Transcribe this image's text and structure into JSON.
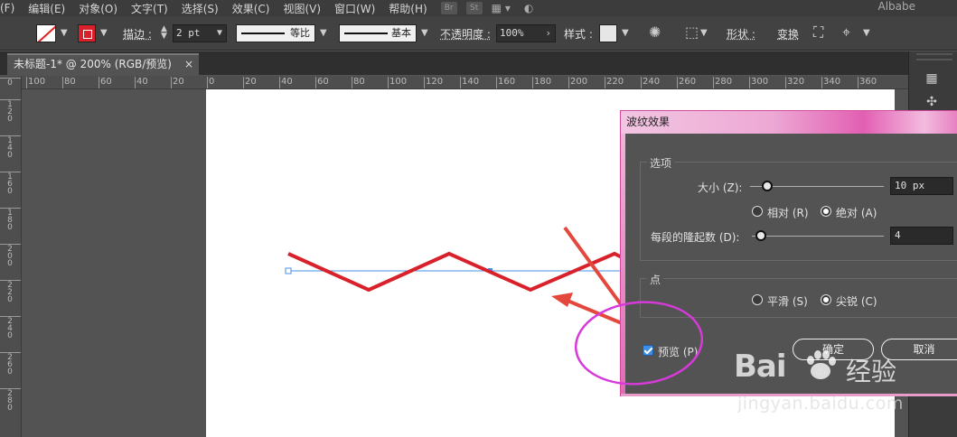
{
  "menubar": {
    "items": [
      "(F)",
      "编辑(E)",
      "对象(O)",
      "文字(T)",
      "选择(S)",
      "效果(C)",
      "视图(V)",
      "窗口(W)",
      "帮助(H)"
    ],
    "badges": [
      "Br",
      "St"
    ],
    "workspace": "Albabe"
  },
  "control_bar": {
    "stroke_label": "描边 :",
    "stroke_weight": "2 pt",
    "profile_label": "等比",
    "brush_label": "基本",
    "opacity_label": "不透明度 :",
    "opacity_value": "100%",
    "style_label": "样式 :",
    "shape_label": "形状 :",
    "transform_label": "变换"
  },
  "document": {
    "tab_title": "未标题-1* @ 200% (RGB/预览)",
    "close_glyph": "×"
  },
  "rulers": {
    "h_ticks": [
      "100",
      "80",
      "60",
      "40",
      "20",
      "0",
      "20",
      "40",
      "60",
      "80",
      "100",
      "120",
      "140",
      "160",
      "180",
      "200",
      "220",
      "240",
      "260",
      "280",
      "300",
      "320",
      "340",
      "360"
    ],
    "v_ticks": [
      "0",
      "120",
      "140",
      "160",
      "180",
      "200",
      "220",
      "240",
      "260",
      "280"
    ]
  },
  "colors": {
    "zigzag_stroke": "#d8212b",
    "guide_line": "#4a90e2",
    "arrow": "#e4473c",
    "highlight_circle": "#d63ad8",
    "dialog_accent": "#e25fb3"
  },
  "dialog": {
    "title": "波纹效果",
    "options_group": "选项",
    "size_label": "大小 (Z):",
    "size_value": "10 px",
    "size_slider": 0.14,
    "relative_label": "相对 (R)",
    "absolute_label": "绝对 (A)",
    "absolute_selected": true,
    "ridges_label": "每段的隆起数 (D):",
    "ridges_value": "4",
    "ridges_slider": 0.04,
    "points_group": "点",
    "smooth_label": "平滑 (S)",
    "corner_label": "尖锐 (C)",
    "corner_selected": true,
    "preview_label": "预览 (P)",
    "preview_checked": true,
    "ok_label": "确定",
    "cancel_label": "取消"
  },
  "watermark": {
    "brand": "Bai",
    "brand_cn": "经验",
    "url": "jingyan.baidu.com"
  }
}
